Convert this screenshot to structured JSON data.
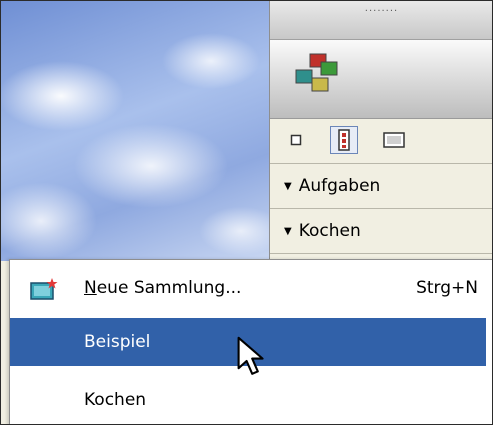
{
  "panel": {
    "grip": "········",
    "collection_icon": "collection-icon",
    "view_buttons": [
      {
        "icon": "small-square-view-icon",
        "selected": false
      },
      {
        "icon": "filmstrip-view-icon",
        "selected": true
      },
      {
        "icon": "large-view-icon",
        "selected": false
      }
    ],
    "sections": [
      {
        "label": "Aufgaben",
        "icon": "triangle-down-icon"
      },
      {
        "label": "Kochen",
        "icon": "triangle-down-icon"
      }
    ]
  },
  "menu": {
    "items": [
      {
        "label_first": "N",
        "label_rest": "eue Sammlung...",
        "shortcut": "Strg+N",
        "icon": "new-collection-icon"
      },
      {
        "label": "Beispiel",
        "highlighted": true
      },
      {
        "label": "Kochen",
        "highlighted": false
      }
    ]
  },
  "colors": {
    "highlight": "#3161a9",
    "panel_bg": "#f1efe2",
    "selection_border": "#6b86b8"
  }
}
